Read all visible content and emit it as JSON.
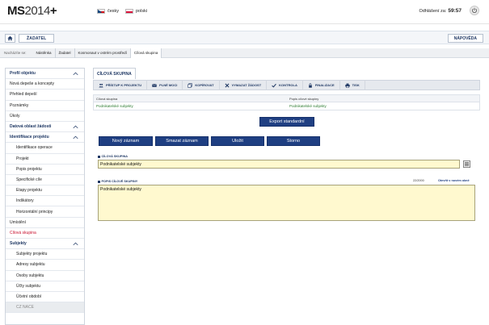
{
  "header": {
    "logo_main": "MS",
    "logo_year": "2014",
    "logo_plus": "+",
    "lang_cz": "česky",
    "lang_pl": "polski",
    "logout_label": "Odhlášení za:",
    "logout_time": "59:57"
  },
  "nav": {
    "zadatel_label": "ŽADATEL",
    "help_label": "NÁPOVĚDA"
  },
  "breadcrumb": {
    "label": "Nacházíte se:",
    "items": [
      "Nástěnka",
      "Žadatel",
      "Kosmonaut v ostrém prostředí",
      "Cílová skupina"
    ]
  },
  "sidebar": {
    "items": [
      {
        "label": "Profil objektu"
      },
      {
        "label": "Nová depeše a koncepty"
      },
      {
        "label": "Přehled depeší"
      },
      {
        "label": "Poznámky"
      },
      {
        "label": "Úkoly"
      },
      {
        "label": "Datová oblast žádosti"
      },
      {
        "label": "Identifikace projektu"
      },
      {
        "label": "Identifikace operace"
      },
      {
        "label": "Projekt"
      },
      {
        "label": "Popis projektu"
      },
      {
        "label": "Specifické cíle"
      },
      {
        "label": "Etapy projektu"
      },
      {
        "label": "Indikátory"
      },
      {
        "label": "Horizontální principy"
      },
      {
        "label": "Umístění"
      },
      {
        "label": "Cílová skupina"
      },
      {
        "label": "Subjekty"
      },
      {
        "label": "Subjekty projektu"
      },
      {
        "label": "Adresy subjektu"
      },
      {
        "label": "Osoby subjektu"
      },
      {
        "label": "Účty subjektu"
      },
      {
        "label": "Účetní období"
      },
      {
        "label": "CZ NACE"
      }
    ]
  },
  "main": {
    "tab_label": "CÍLOVÁ SKUPINA",
    "toolbar": {
      "access": "PŘÍSTUP K PROJEKTU",
      "plne_moci": "PLNÉ MOCI",
      "copy": "KOPÍROVAT",
      "delete": "VYMAZAT ŽÁDOST",
      "check": "KONTROLA",
      "finalize": "FINALIZACE",
      "print": "TISK"
    },
    "grid": {
      "col1": "Cílová skupina",
      "col2": "Popis cílové skupiny",
      "row1_col1": "Podnikatelské subjekty",
      "row1_col2": "Podnikatelské subjekty"
    },
    "export_label": "Export standardní",
    "buttons": {
      "new": "Nový záznam",
      "delete": "Smazat záznam",
      "save": "Uložit",
      "cancel": "Storno"
    },
    "field_target_label": "CÍLOVÁ SKUPINA",
    "field_target_value": "Podnikatelské subjekty",
    "field_desc_label": "POPIS CÍLOVÉ SKUPINY",
    "field_desc_counter": "22/2000",
    "field_desc_fullscreen": "Otevřít v novém okně",
    "field_desc_value": "Podnikatelské subjekty"
  },
  "colors": {
    "primary": "#1f3f82",
    "field_bg": "#fff9cf",
    "link_green": "#2e7d32",
    "current_red": "#c8102e"
  }
}
